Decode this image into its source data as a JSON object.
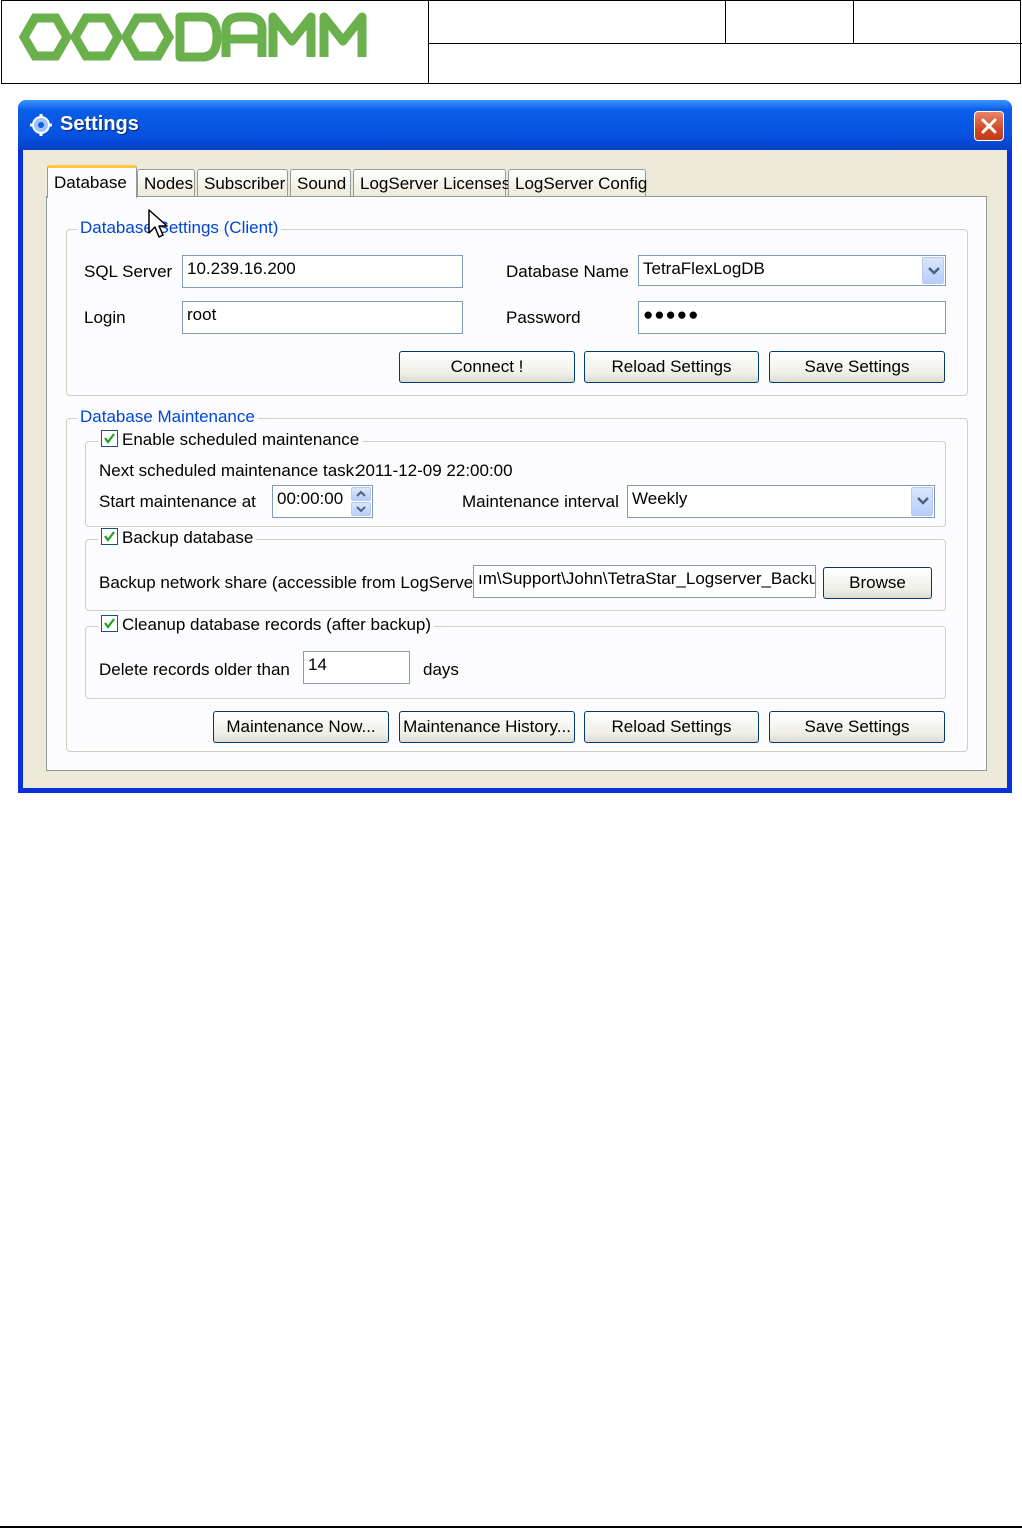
{
  "window": {
    "title": "Settings"
  },
  "tabs": [
    {
      "label": "Database",
      "active": true
    },
    {
      "label": "Nodes"
    },
    {
      "label": "Subscriber"
    },
    {
      "label": "Sound"
    },
    {
      "label": "LogServer Licenses"
    },
    {
      "label": "LogServer Config"
    }
  ],
  "client": {
    "legend": "Database Settings (Client)",
    "sql_server_label": "SQL Server",
    "sql_server_value": "10.239.16.200",
    "login_label": "Login",
    "login_value": "root",
    "db_name_label": "Database Name",
    "db_name_value": "TetraFlexLogDB",
    "password_label": "Password",
    "password_value": "●●●●●",
    "connect_label": "Connect !",
    "reload_label": "Reload Settings",
    "save_label": "Save Settings"
  },
  "maintenance": {
    "legend": "Database Maintenance",
    "schedule": {
      "checkbox_label": "Enable scheduled maintenance",
      "next_label": "Next scheduled maintenance task:",
      "next_value": "2011-12-09 22:00:00",
      "start_label": "Start maintenance at",
      "start_value": "00:00:00",
      "interval_label": "Maintenance interval",
      "interval_value": "Weekly"
    },
    "backup": {
      "checkbox_label": "Backup database",
      "share_label": "Backup network share (accessible from LogServer)",
      "share_value": "ım\\Support\\John\\TetraStar_Logserver_Backup",
      "browse_label": "Browse"
    },
    "cleanup": {
      "checkbox_label": "Cleanup database records (after backup)",
      "delete_label": "Delete records older than",
      "delete_value": "14",
      "days_label": "days"
    },
    "now_label": "Maintenance Now...",
    "history_label": "Maintenance History...",
    "reload_label": "Reload Settings",
    "save_label": "Save Settings"
  },
  "colors": {
    "logo_green": "#6ab04c",
    "title_blue": "#0a5ee8",
    "legend_blue": "#0046d5"
  }
}
